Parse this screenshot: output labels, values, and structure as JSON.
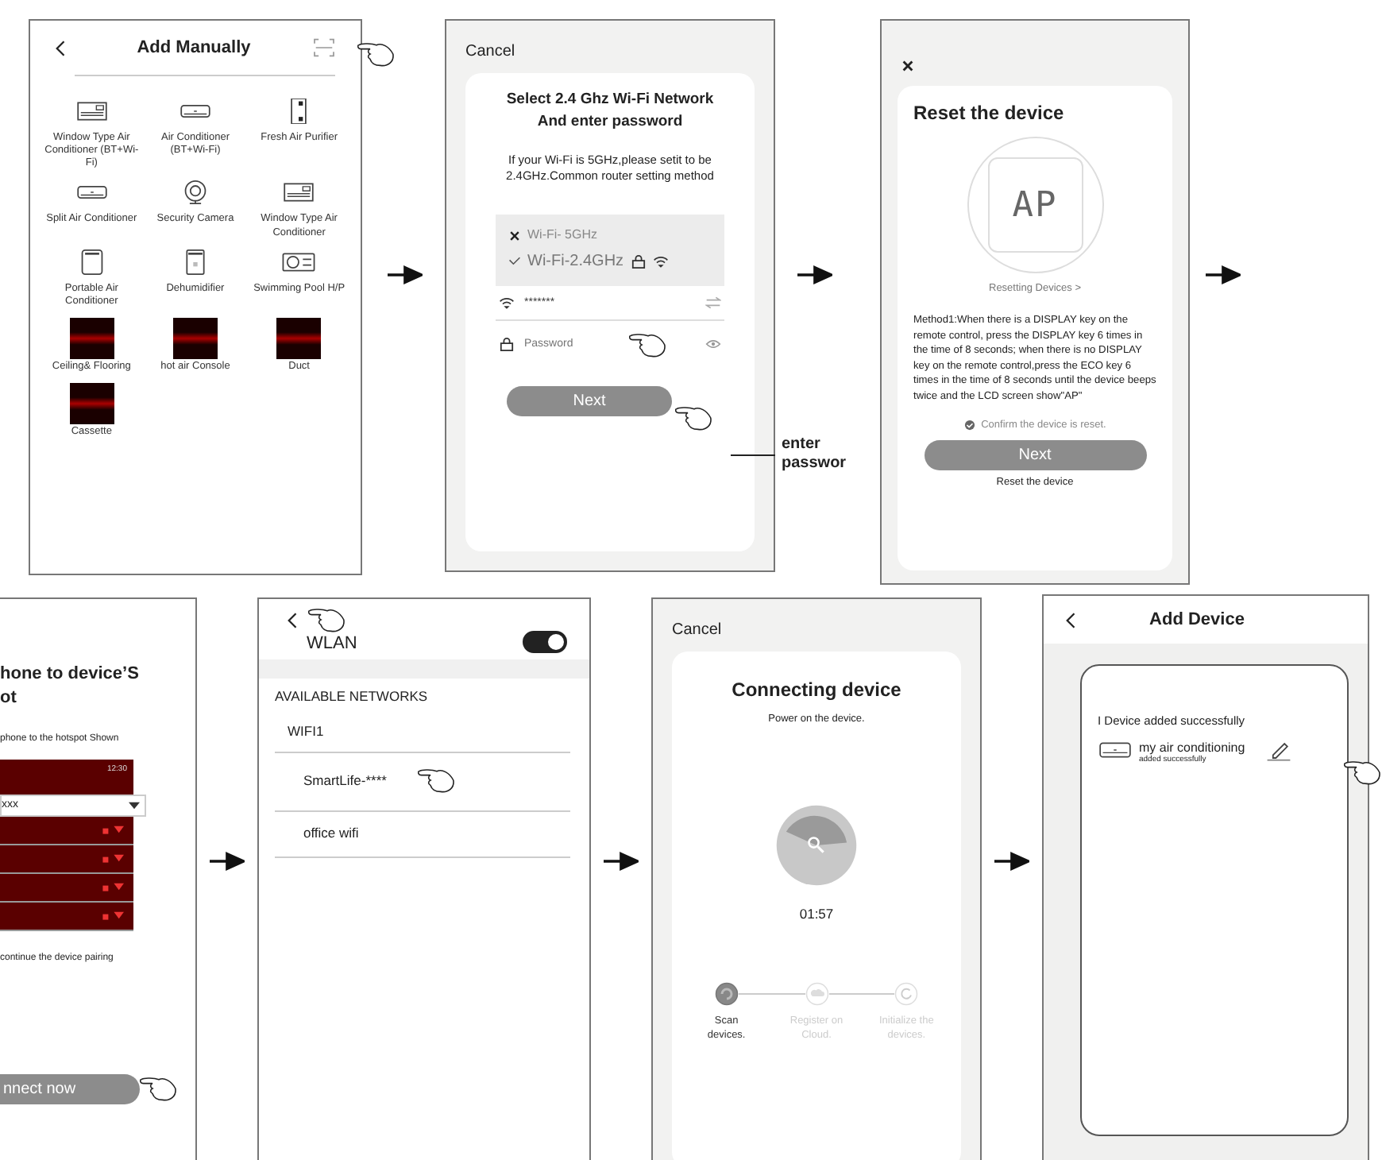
{
  "add_manually": {
    "title": "Add Manually",
    "devices": [
      {
        "label": "Window Type Air Conditioner (BT+Wi-Fi)",
        "kind": "window"
      },
      {
        "label": "Air Conditioner (BT+Wi-Fi)",
        "kind": "split"
      },
      {
        "label": "Fresh Air Purifier",
        "kind": "purifier"
      },
      {
        "label": "Split Air Conditioner",
        "kind": "split"
      },
      {
        "label": "Security Camera",
        "kind": "camera"
      },
      {
        "label": "Window Type Air Conditioner",
        "kind": "window"
      },
      {
        "label": "Portable Air Conditioner",
        "kind": "portable"
      },
      {
        "label": "Dehumidifier",
        "kind": "dehumidifier"
      },
      {
        "label": "Swimming Pool H/P",
        "kind": "pool"
      },
      {
        "label": "Ceiling& Flooring",
        "kind": "thumbnail"
      },
      {
        "label": "hot air Console",
        "kind": "thumbnail"
      },
      {
        "label": "Duct",
        "kind": "thumbnail"
      },
      {
        "label": "Cassette",
        "kind": "thumbnail"
      }
    ]
  },
  "wifi_setup": {
    "cancel": "Cancel",
    "title_lines": [
      "Select 2.4 Ghz Wi-Fi Network",
      "And enter password"
    ],
    "description": "If your Wi-Fi is 5GHz,please setit to be 2.4GHz.Common router setting method",
    "networks": [
      {
        "name": "Wi-Fi- 5GHz",
        "selected": false,
        "secured": false
      },
      {
        "name": "Wi-Fi-2.4GHz",
        "selected": true,
        "secured": true
      }
    ],
    "ssid": "*******",
    "password_placeholder": "Password",
    "button": "Next",
    "callout_lines": [
      "enter",
      "passwor"
    ]
  },
  "reset": {
    "title": "Reset the device",
    "display": "AP",
    "link": "Resetting Devices >",
    "method": "Method1:When there is a DISPLAY key on the remote control, press the DISPLAY key 6 times in the time of 8 seconds; when there is no DISPLAY key on the remote control,press the ECO  key 6 times in the time of 8 seconds until the device beeps twice and the LCD screen show\"AP\"",
    "confirm": "Confirm the device is reset.",
    "button": "Next",
    "footer": "Reset the device"
  },
  "hotspot": {
    "title_lines": [
      "hone to device’S",
      "ot"
    ],
    "instruction": "phone to the hotspot Shown",
    "time": "12:30",
    "network": "xxx",
    "note": "continue the device pairing",
    "button": "nnect now"
  },
  "wlan": {
    "title": "WLAN",
    "on": true,
    "section": "AVAILABLE NETWORKS",
    "networks": [
      "WIFI1",
      "SmartLife-****",
      "office wifi"
    ]
  },
  "connecting": {
    "cancel": "Cancel",
    "title": "Connecting device",
    "subtitle": "Power on the device.",
    "timer": "01:57",
    "steps": [
      {
        "label": "Scan devices.",
        "kind": "scan",
        "active": true
      },
      {
        "label": "Register on Cloud.",
        "kind": "cloud",
        "active": false
      },
      {
        "label": "Initialize the devices.",
        "kind": "init",
        "active": false
      }
    ]
  },
  "add_device": {
    "title": "Add Device",
    "message": "I Device added successfully",
    "device_name": "my air conditioning",
    "device_status": "added successfully"
  }
}
